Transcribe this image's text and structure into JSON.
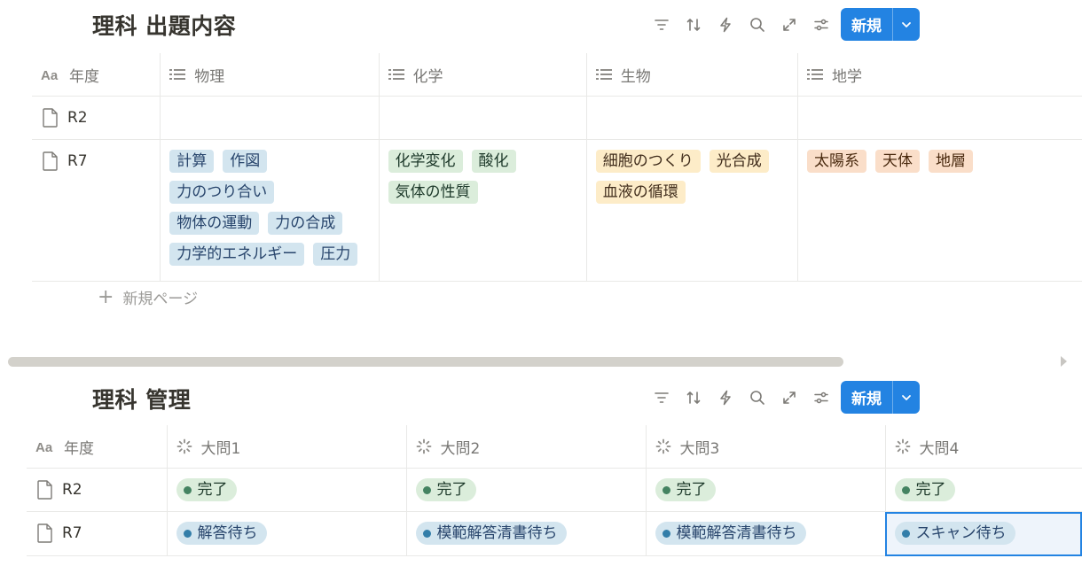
{
  "db1": {
    "title": "理科 出題内容",
    "new_label": "新規",
    "columns": [
      "年度",
      "物理",
      "化学",
      "生物",
      "地学"
    ],
    "rows": [
      {
        "name": "R2"
      },
      {
        "name": "R7",
        "physics": [
          "計算",
          "作図",
          "力のつり合い",
          "物体の運動",
          "力の合成",
          "力学的エネルギー",
          "圧力"
        ],
        "chemistry": [
          "化学変化",
          "酸化",
          "気体の性質"
        ],
        "biology": [
          "細胞のつくり",
          "光合成",
          "血液の循環"
        ],
        "earth": [
          "太陽系",
          "天体",
          "地層"
        ]
      }
    ],
    "add_row_label": "新規ページ"
  },
  "db2": {
    "title": "理科 管理",
    "new_label": "新規",
    "columns": [
      "年度",
      "大問1",
      "大問2",
      "大問3",
      "大問4"
    ],
    "rows": [
      {
        "name": "R2",
        "statuses": [
          "完了",
          "完了",
          "完了",
          "完了"
        ]
      },
      {
        "name": "R7",
        "statuses": [
          "解答待ち",
          "模範解答清書待ち",
          "模範解答清書待ち",
          "スキャン待ち"
        ]
      }
    ]
  },
  "icons": {
    "toolbar": [
      "filter-icon",
      "sort-icon",
      "lightning-icon",
      "search-icon",
      "expand-icon",
      "settings-sliders-icon"
    ],
    "title_prop": "aa-text-icon",
    "multi_select_prop": "list-icon",
    "status_prop": "status-spinner-icon",
    "row": "page-icon"
  },
  "colors": {
    "accent": "#2383e2",
    "tag_blue": "#d3e5ef",
    "tag_green": "#dbeddb",
    "tag_yellow": "#fdecc8",
    "tag_orange": "#fadec9"
  }
}
